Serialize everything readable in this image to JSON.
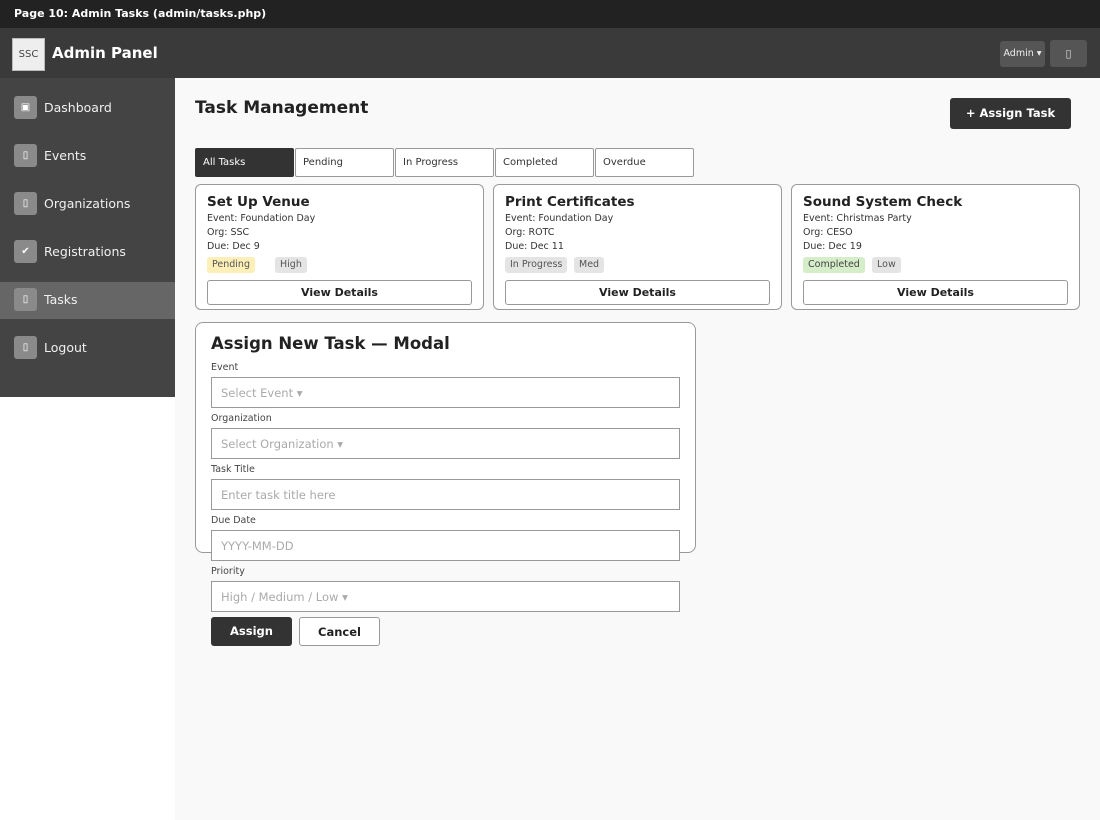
{
  "page_label": "Page 10: Admin Tasks (admin/tasks.php)",
  "header": {
    "logo_text": "SSC",
    "app_title": "Admin Panel",
    "user_menu": "Admin ▾",
    "icon_button": "▯"
  },
  "sidebar": {
    "items": [
      {
        "icon": "▣",
        "label": "Dashboard"
      },
      {
        "icon": "▯",
        "label": "Events"
      },
      {
        "icon": "▯",
        "label": "Organizations"
      },
      {
        "icon": "✔",
        "label": "Registrations"
      },
      {
        "icon": "▯",
        "label": "Tasks"
      },
      {
        "icon": "▯",
        "label": "Logout"
      }
    ],
    "active_item": "Tasks"
  },
  "main": {
    "title": "Task Management",
    "assign_button": "+ Assign Task",
    "tabs": [
      "All Tasks",
      "Pending",
      "In Progress",
      "Completed",
      "Overdue"
    ],
    "active_tab": "All Tasks"
  },
  "cards": [
    {
      "title": "Set Up Venue",
      "event": "Event: Foundation Day",
      "org": "Org: SSC",
      "due": "Due: Dec 9",
      "status": "Pending",
      "priority": "High",
      "button": "View Details"
    },
    {
      "title": "Print Certificates",
      "event": "Event: Foundation Day",
      "org": "Org: ROTC",
      "due": "Due: Dec 11",
      "status": "In Progress",
      "priority": "Med",
      "button": "View Details"
    },
    {
      "title": "Sound System Check",
      "event": "Event: Christmas Party",
      "org": "Org: CESO",
      "due": "Due: Dec 19",
      "status": "Completed",
      "priority": "Low",
      "button": "View Details"
    }
  ],
  "modal": {
    "title": "Assign New Task — Modal",
    "fields": [
      {
        "label": "Event",
        "placeholder": "Select Event ▾"
      },
      {
        "label": "Organization",
        "placeholder": "Select Organization ▾"
      },
      {
        "label": "Task Title",
        "placeholder": "Enter task title here"
      },
      {
        "label": "Due Date",
        "placeholder": "YYYY-MM-DD"
      },
      {
        "label": "Priority",
        "placeholder": "High / Medium / Low ▾"
      }
    ],
    "assign_button": "Assign",
    "cancel_button": "Cancel"
  },
  "colors": {
    "topbar": "#3a3a3a",
    "sidebar": "#444444",
    "sidebar_active": "#666666",
    "primary_button": "#333333",
    "badge_pending": "#fdefb8",
    "badge_completed": "#d6edc9",
    "badge_neutral": "#e4e4e4"
  }
}
